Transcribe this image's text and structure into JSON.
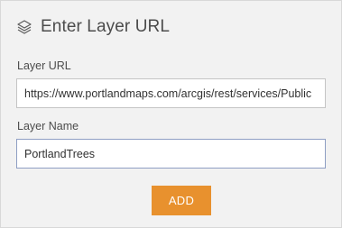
{
  "dialog": {
    "title": "Enter Layer URL",
    "icon": "layers-icon"
  },
  "layer_url": {
    "label": "Layer URL",
    "value": "https://www.portlandmaps.com/arcgis/rest/services/Public"
  },
  "layer_name": {
    "label": "Layer Name",
    "value": "PortlandTrees"
  },
  "add_button": {
    "label": "ADD",
    "color": "#e8912e"
  }
}
